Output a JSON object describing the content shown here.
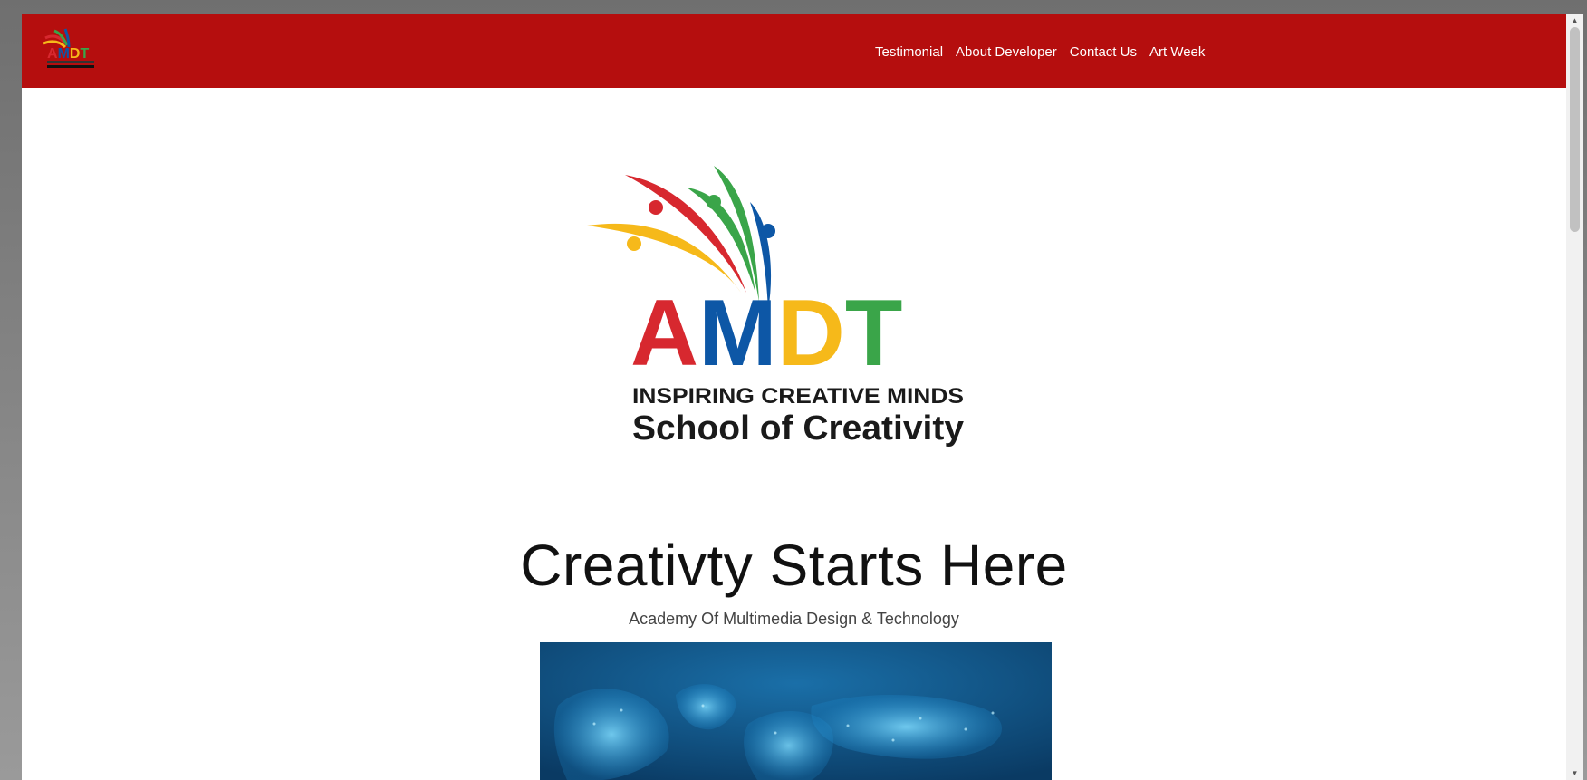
{
  "navbar": {
    "links": [
      "Testimonial",
      "About Developer",
      "Contact Us",
      "Art Week"
    ]
  },
  "brand_logo": {
    "wordmark": "AMDT",
    "tagline": "INSPIRING CREATIVE MINDS",
    "subtitle": "School of Creativity"
  },
  "hero": {
    "title": "Creativty Starts Here",
    "subtitle": "Academy Of Multimedia Design & Technology",
    "image": "world-map-network-icon"
  },
  "colors": {
    "nav_bg": "#b50e0e",
    "red": "#d7282f",
    "green": "#3aa549",
    "blue": "#0d57a6",
    "yellow": "#f6b91a",
    "map_bg": "#0b4a7a",
    "map_glow": "#4fc3f7"
  }
}
